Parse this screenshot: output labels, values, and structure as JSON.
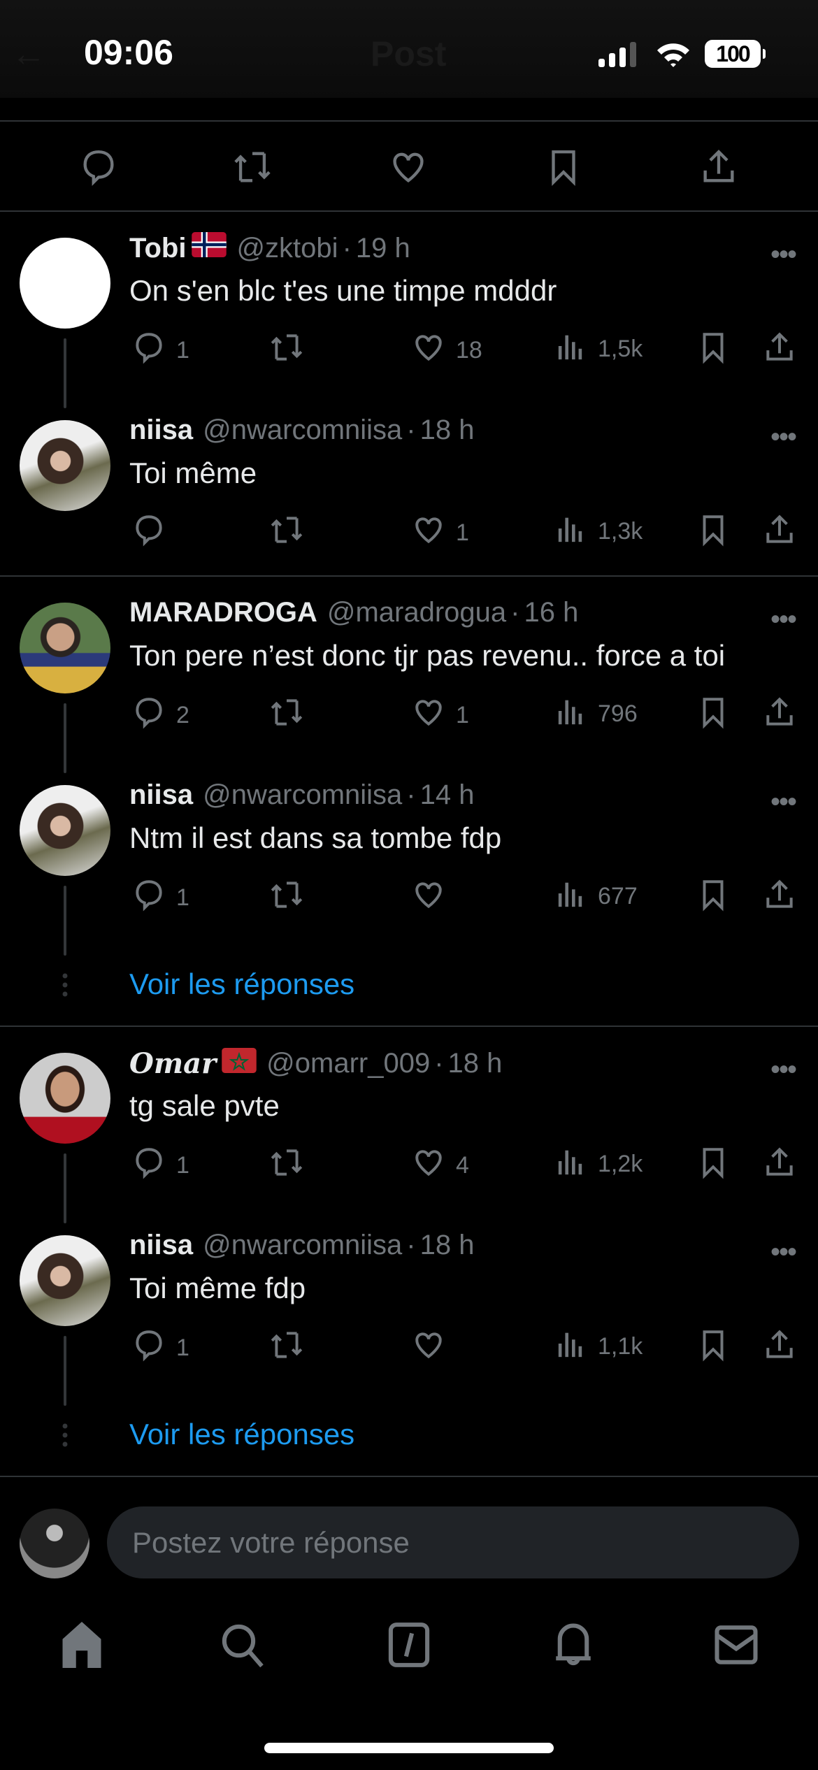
{
  "status": {
    "time": "09:06",
    "battery": "100"
  },
  "header": {
    "title": "Post",
    "back": "←"
  },
  "colors": {
    "accent": "#1d9bf0",
    "muted": "#71767b",
    "text": "#e7e9ea"
  },
  "threads": [
    {
      "tweets": [
        {
          "name": "Tobi",
          "flag": "norway",
          "handle": "@zktobi",
          "time": "19 h",
          "text": "On s'en blc t'es une timpe mdddr",
          "replies": "1",
          "retweets": "",
          "likes": "18",
          "views": "1,5k",
          "avatar": "white"
        },
        {
          "name": "niisa",
          "handle": "@nwarcomniisa",
          "time": "18 h",
          "text": "Toi même",
          "replies": "",
          "retweets": "",
          "likes": "1",
          "views": "1,3k",
          "avatar": "girl"
        }
      ]
    },
    {
      "tweets": [
        {
          "name": "MARADROGA",
          "handle": "@maradrogua",
          "time": "16 h",
          "text": "Ton pere n’est donc tjr pas revenu.. force a toi",
          "replies": "2",
          "retweets": "",
          "likes": "1",
          "views": "796",
          "avatar": "man"
        },
        {
          "name": "niisa",
          "handle": "@nwarcomniisa",
          "time": "14 h",
          "text": "Ntm il est dans sa tombe fdp",
          "replies": "1",
          "retweets": "",
          "likes": "",
          "views": "677",
          "avatar": "girl"
        }
      ],
      "show_replies": "Voir les réponses"
    },
    {
      "tweets": [
        {
          "name": "Omar",
          "flag": "morocco",
          "serif": true,
          "handle": "@omarr_009",
          "time": "18 h",
          "text": "tg sale pvte",
          "replies": "1",
          "retweets": "",
          "likes": "4",
          "views": "1,2k",
          "avatar": "player"
        },
        {
          "name": "niisa",
          "handle": "@nwarcomniisa",
          "time": "18 h",
          "text": "Toi même fdp",
          "replies": "1",
          "retweets": "",
          "likes": "",
          "views": "1,1k",
          "avatar": "girl"
        }
      ],
      "show_replies": "Voir les réponses"
    }
  ],
  "reply_box": {
    "placeholder": "Postez votre réponse"
  },
  "meta_separator": "·",
  "more_label": "•••"
}
